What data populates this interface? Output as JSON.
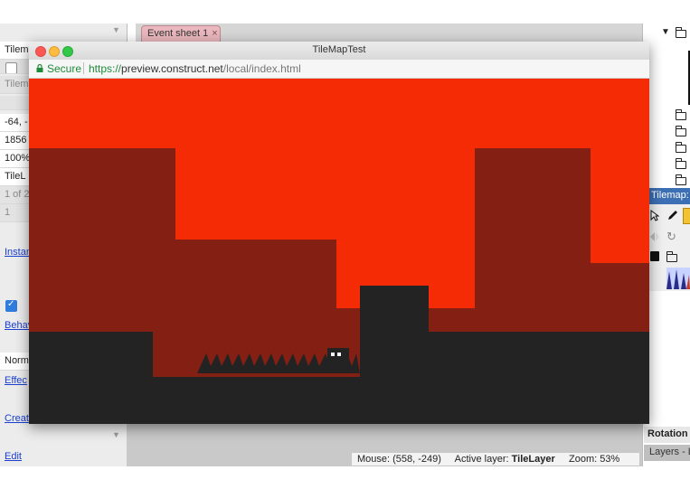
{
  "browser": {
    "window_title": "TileMapTest",
    "secure_label": "Secure",
    "url": {
      "protocol": "https://",
      "host": "preview.construct.net",
      "path": "/local/index.html"
    }
  },
  "editor": {
    "event_tab": {
      "label": "Event sheet 1",
      "close": "×"
    },
    "left_panel": {
      "rows": [
        "Tilem",
        "Tilem",
        "-64, -",
        "1856",
        "100%",
        "TileL",
        "1 of 2",
        "1"
      ],
      "links": [
        "Instan",
        "Behav",
        "Effec",
        "Creat",
        "Edit"
      ],
      "dropdown_value": "Norm"
    },
    "status_bar": {
      "mouse_label": "Mouse:",
      "mouse_value": "(558, -249)",
      "layer_label": "Active layer:",
      "layer_value": "TileLayer",
      "zoom_label": "Zoom:",
      "zoom_value": "53%"
    },
    "right_panel": {
      "tilemap_header": "Tilemap: T",
      "rotation_header": "Rotation",
      "layers_tab": "Layers - L"
    }
  },
  "colors": {
    "sky": "#f42b05",
    "background_blocks": "#842013",
    "ground": "#232323",
    "secure_green": "#1f8a3a",
    "link_blue": "#1a3fd1",
    "tilemap_header": "#3d6fb5",
    "event_tab": "#e9b7bd"
  },
  "icons": {
    "lock": "lock-icon",
    "close_tab": "close-icon",
    "traffic_lights": [
      "close-window-icon",
      "minimize-window-icon",
      "zoom-window-icon"
    ],
    "tree_toggle": "triangle-down-icon",
    "folders": "folder-icon",
    "tools": [
      "select-arrow-icon",
      "pencil-icon",
      "eraser-icon",
      "rotate-icon",
      "flip-icon",
      "save-icon"
    ]
  }
}
